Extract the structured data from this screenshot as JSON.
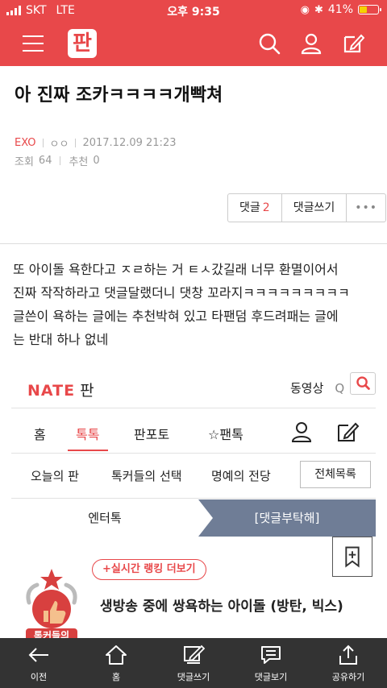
{
  "status_bar": {
    "carrier": "SKT",
    "network": "LTE",
    "time": "오후 9:35",
    "battery": "41%"
  },
  "header": {
    "logo_text": "판"
  },
  "post": {
    "title": "아 진짜 조카ㅋㅋㅋㅋ개빡쳐",
    "category": "EXO",
    "author": "ㅇㅇ",
    "date": "2017.12.09 21:23",
    "views_label": "조회",
    "views": "64",
    "recommend_label": "추천",
    "recommend": "0"
  },
  "actions": {
    "comments_label": "댓글",
    "comments_count": "2",
    "write_comment": "댓글쓰기",
    "more": "•••"
  },
  "body_lines": [
    "또 아이돌 욕한다고 ㅈㄹ하는 거 ㅌㅅ갔길래 너무 환멸이어서",
    "진짜 작작하라고 댓글달랬더니 댓창 꼬라지ㅋㅋㅋㅋㅋㅋㅋㅋㅋ",
    "글쓴이 욕하는 글에는 추천박혀 있고 타팬덤 후드려패는 글에",
    "는 반대 하나 없네"
  ],
  "embed": {
    "logo": "NATE",
    "logo_suffix": "판",
    "video": "동영상",
    "video_suffix": "Q",
    "nav": [
      "홈",
      "톡톡",
      "판포토",
      "☆팬톡"
    ],
    "subnav": [
      "오늘의 판",
      "톡커들의 선택",
      "명예의 전당"
    ],
    "all_list": "전체목록",
    "tab_left": "엔터톡",
    "tab_right": "[댓글부탁해]",
    "rank_button": "+실시간 랭킹 더보기",
    "badge_text": "톡커들의",
    "hot_title": "생방송 중에 쌍욕하는 아이돌 (방탄, 빅스)"
  },
  "bottom_nav": [
    "이전",
    "홈",
    "댓글쓰기",
    "댓글보기",
    "공유하기"
  ],
  "colors": {
    "accent": "#e8484a",
    "tab_blue": "#6f7d96",
    "bottom_bar": "#333333"
  }
}
